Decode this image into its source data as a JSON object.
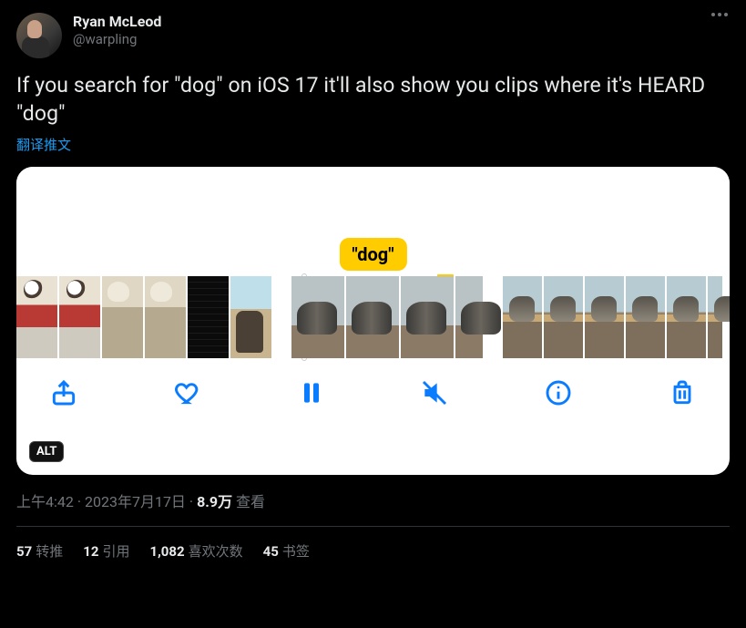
{
  "author": {
    "display_name": "Ryan McLeod",
    "handle": "@warpling"
  },
  "tweet_text": "If you search for \"dog\" on iOS 17 it'll also show you clips where it's HEARD \"dog\"",
  "translate_label": "翻译推文",
  "media": {
    "chip_text": "\"dog\"",
    "alt_badge": "ALT"
  },
  "meta": {
    "time": "上午4:42",
    "dot": " · ",
    "date": "2023年7月17日",
    "views_count": "8.9万",
    "views_label": " 查看"
  },
  "stats": {
    "retweets": {
      "count": "57",
      "label": "转推"
    },
    "quotes": {
      "count": "12",
      "label": "引用"
    },
    "likes": {
      "count": "1,082",
      "label": "喜欢次数"
    },
    "bookmarks": {
      "count": "45",
      "label": "书签"
    }
  }
}
